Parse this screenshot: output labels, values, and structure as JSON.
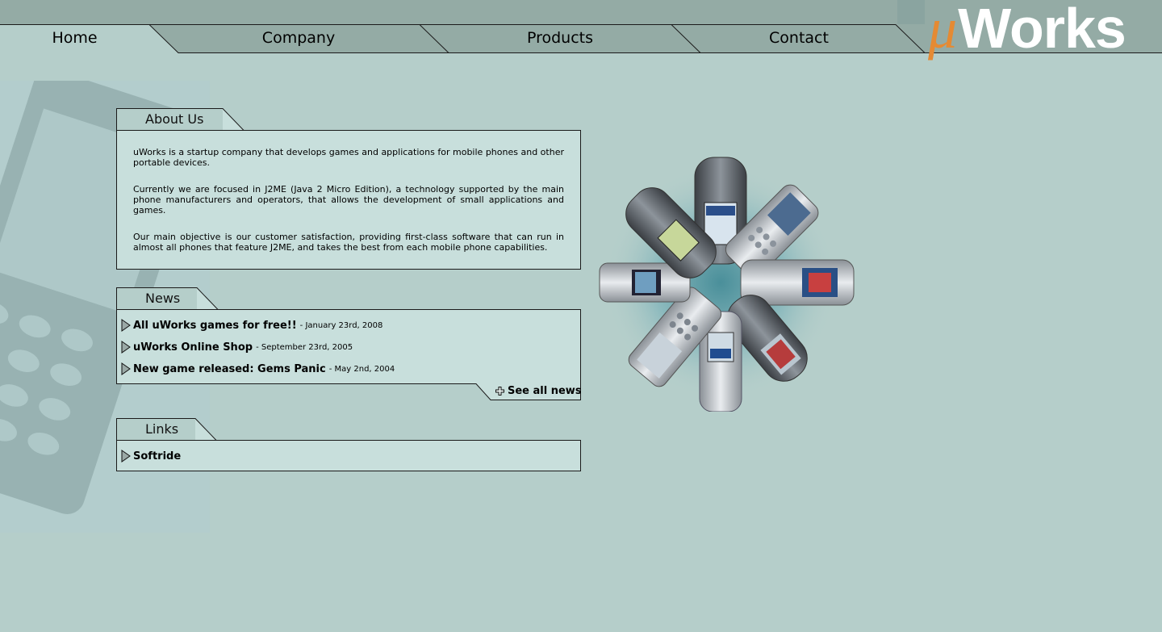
{
  "nav": {
    "items": [
      {
        "label": "Home"
      },
      {
        "label": "Company"
      },
      {
        "label": "Products"
      },
      {
        "label": "Contact"
      }
    ]
  },
  "logo": {
    "mu": "μ",
    "text": "Works"
  },
  "about": {
    "title": "About Us",
    "paragraphs": [
      "uWorks is a startup company that develops games and applications for mobile phones and other portable devices.",
      "Currently we are focused in J2ME (Java 2 Micro Edition), a technology supported by the main phone manufacturers and operators, that allows the development of small applications and games.",
      "Our main objective is our customer satisfaction, providing first-class software that can run in almost all phones that feature J2ME, and takes the best from each mobile phone capabilities."
    ]
  },
  "news": {
    "title": "News",
    "items": [
      {
        "title": "All uWorks games for free!!",
        "date": "- January 23rd, 2008"
      },
      {
        "title": "uWorks Online Shop",
        "date": "- September 23rd, 2005"
      },
      {
        "title": "New game released: Gems Panic",
        "date": "- May 2nd, 2004"
      }
    ],
    "see_all": "See all news"
  },
  "links": {
    "title": "Links",
    "items": [
      {
        "title": "Softride"
      }
    ]
  },
  "colors": {
    "background": "#b5ceca",
    "topbar": "#94aba5",
    "active_tab": "#b5ceca",
    "panel": "#c8dfdc",
    "logo_accent": "#e58a33"
  },
  "icons": [
    "phone-watermark-icon",
    "triangle-bullet-icon",
    "plus-icon"
  ]
}
